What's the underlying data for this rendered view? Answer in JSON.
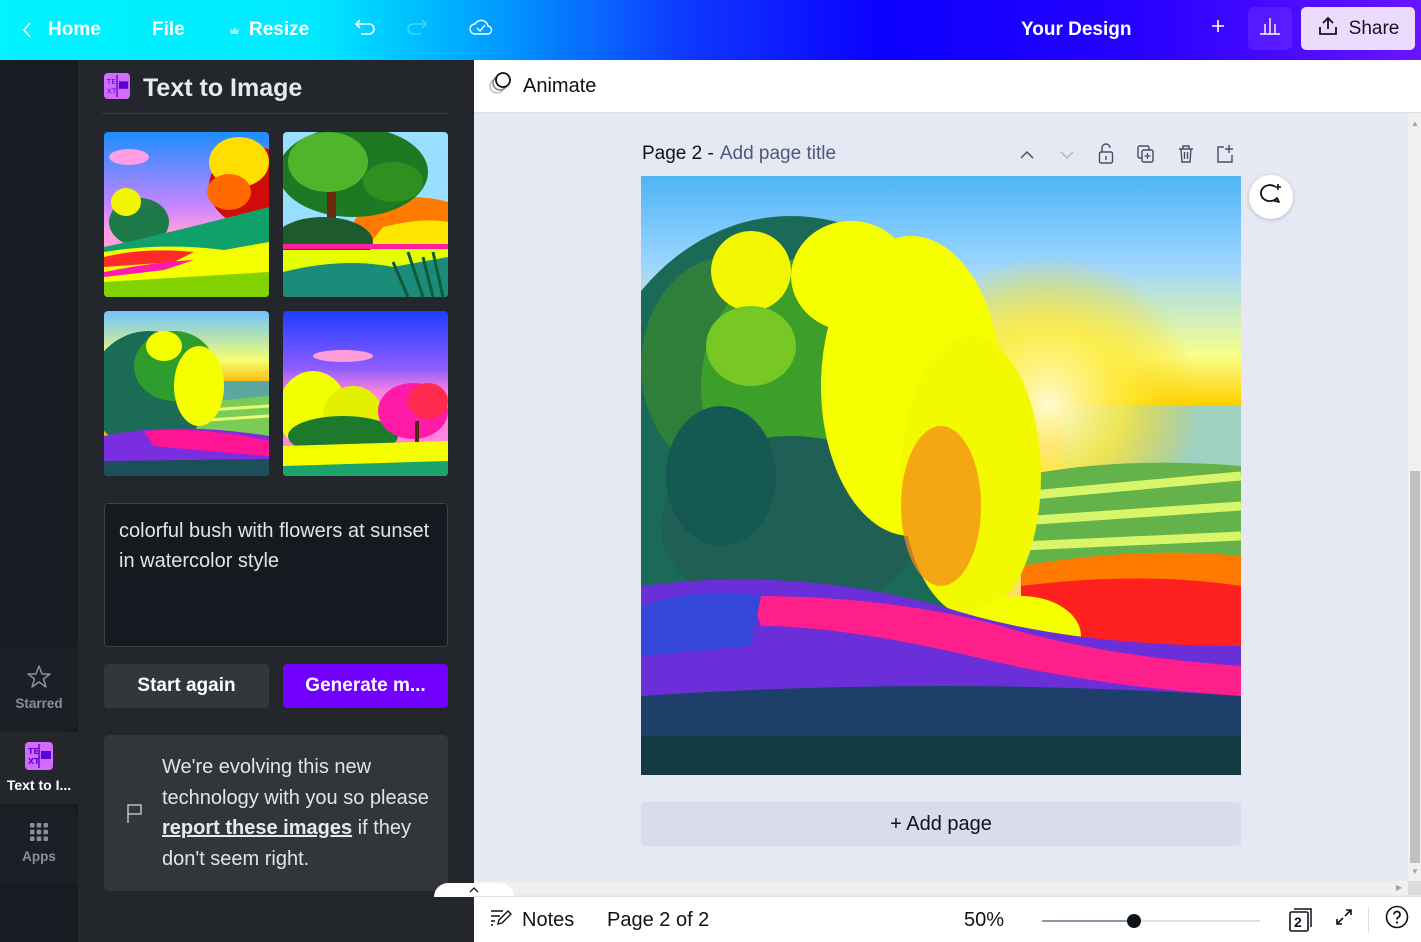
{
  "topbar": {
    "home_label": "Home",
    "file_label": "File",
    "resize_label": "Resize",
    "design_title": "Your Design",
    "share_label": "Share"
  },
  "rail": {
    "starred_label": "Starred",
    "text_to_image_label": "Text to I...",
    "apps_label": "Apps"
  },
  "panel": {
    "title": "Text to Image",
    "thumbnails": [
      {
        "alt": "Generated image 1 - tree on hillside with flowers"
      },
      {
        "alt": "Generated image 2 - large tree at sunset"
      },
      {
        "alt": "Generated image 3 - bush with lavender flowers at sunset"
      },
      {
        "alt": "Generated image 4 - pink tree in meadow"
      }
    ],
    "prompt_value": "colorful bush with flowers at sunset in watercolor style",
    "start_again_label": "Start again",
    "generate_label": "Generate m...",
    "notice_before": "We're evolving this new technology with you so please ",
    "notice_link": "report these images",
    "notice_after": " if they don't seem right."
  },
  "canvas": {
    "animate_label": "Animate",
    "page_label": "Page 2 -",
    "page_title_placeholder": "Add page title",
    "add_page_label": "+ Add page"
  },
  "bottombar": {
    "notes_label": "Notes",
    "page_indicator": "Page 2 of 2",
    "zoom_percent": "50%",
    "zoom_value": 50,
    "zoom_slider_fraction": 0.42,
    "page_count_badge": "2"
  },
  "colors": {
    "accent_purple": "#7200ff",
    "panel_bg": "#23262b",
    "share_bg": "#ecdaff"
  }
}
